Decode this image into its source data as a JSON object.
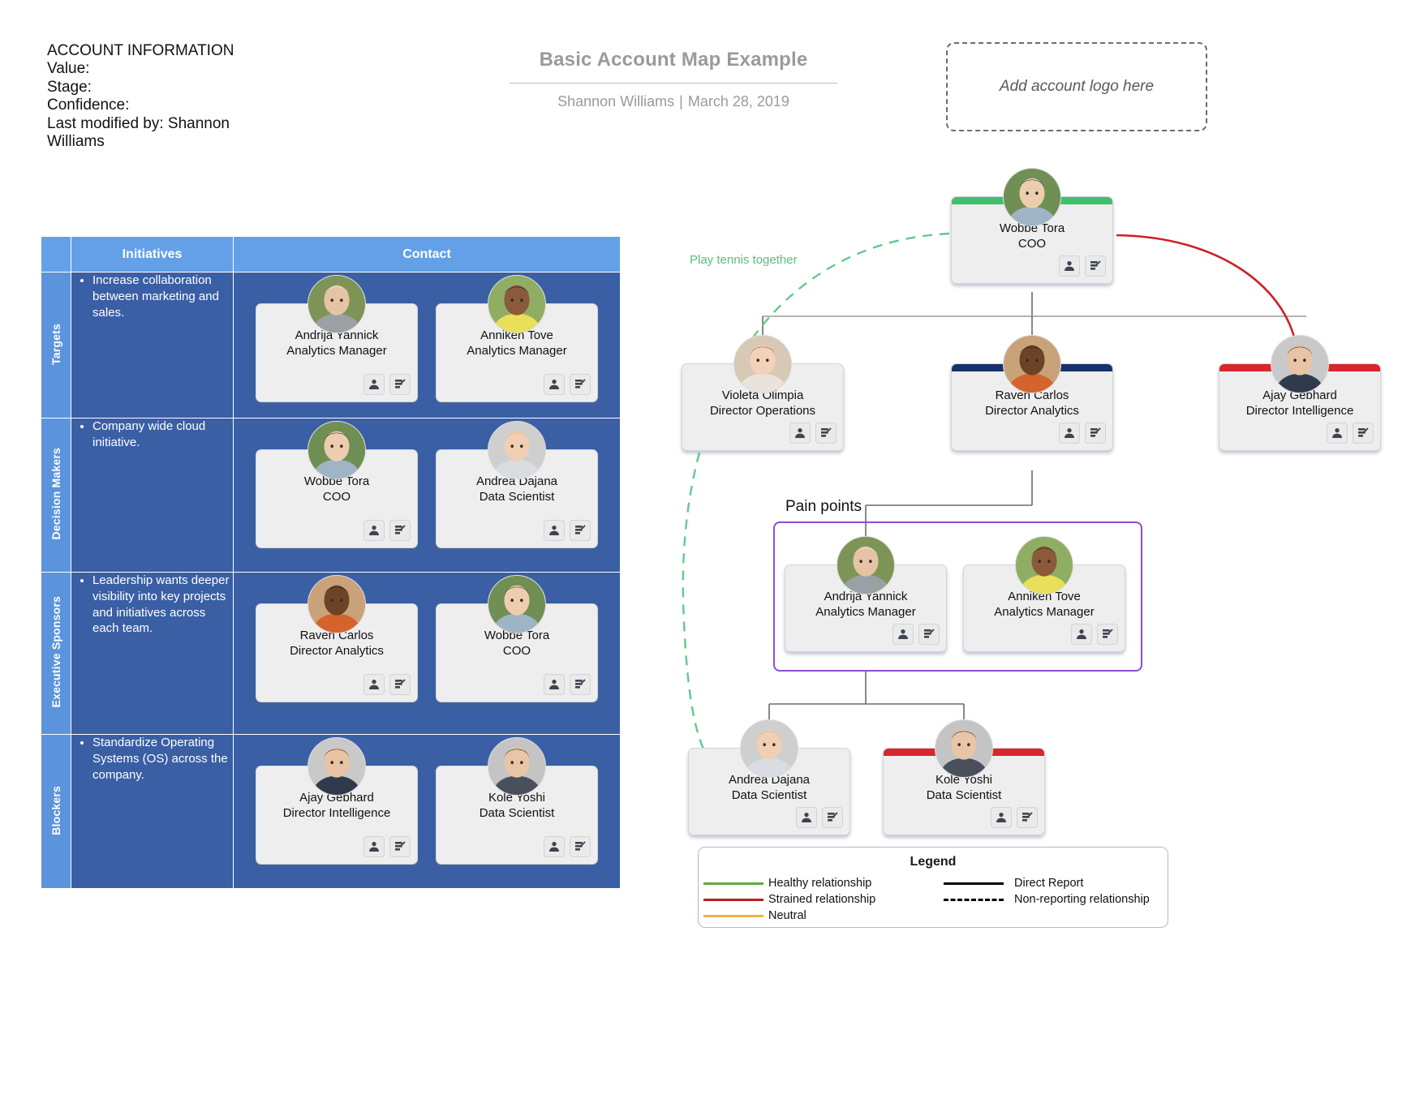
{
  "account_info": {
    "heading": "ACCOUNT INFORMATION",
    "value_label": "Value:",
    "stage_label": "Stage:",
    "confidence_label": "Confidence:",
    "last_modified": "Last modified by: Shannon Williams"
  },
  "title_block": {
    "title": "Basic Account Map Example",
    "author": "Shannon Williams",
    "separator": "|",
    "date": "March 28, 2019"
  },
  "logo_box": {
    "placeholder": "Add account logo here"
  },
  "matrix": {
    "headers": {
      "blank": "",
      "initiatives": "Initiatives",
      "contact": "Contact"
    },
    "rows": [
      {
        "label": "Targets",
        "initiatives": [
          "Increase collaboration between marketing and sales."
        ],
        "contacts": [
          {
            "name": "Andrija Yannick",
            "role": "Analytics Manager",
            "avatar": "older-man-beard"
          },
          {
            "name": "Anniken Tove",
            "role": "Analytics Manager",
            "avatar": "woman-curly-hair"
          }
        ]
      },
      {
        "label": "Decision Makers",
        "initiatives": [
          "Company wide cloud initiative."
        ],
        "contacts": [
          {
            "name": "Wobbe Tora",
            "role": "COO",
            "avatar": "woman-dark-hair"
          },
          {
            "name": "Andrea Dajana",
            "role": "Data Scientist",
            "avatar": "woman-blonde"
          }
        ]
      },
      {
        "label": "Executive Sponsors",
        "initiatives": [
          "Leadership wants deeper visibility into key projects and initiatives across each team."
        ],
        "contacts": [
          {
            "name": "Raven Carlos",
            "role": "Director Analytics",
            "avatar": "man-dark-skin"
          },
          {
            "name": "Wobbe Tora",
            "role": "COO",
            "avatar": "woman-dark-hair"
          }
        ]
      },
      {
        "label": "Blockers",
        "initiatives": [
          "Standardize Operating Systems (OS) across the company."
        ],
        "contacts": [
          {
            "name": "Ajay Gebhard",
            "role": "Director Intelligence",
            "avatar": "man-glasses-beard"
          },
          {
            "name": "Kole Yoshi",
            "role": "Data Scientist",
            "avatar": "man-asian"
          }
        ]
      }
    ]
  },
  "org_chart": {
    "annotations": {
      "tennis": "Play tennis together",
      "pain_points": "Pain points"
    },
    "nodes": [
      {
        "id": "wobbe",
        "name": "Wobbe Tora",
        "role": "COO",
        "avatar": "woman-dark-hair",
        "status": "healthy",
        "top_color": "#3fbf6f"
      },
      {
        "id": "violeta",
        "name": "Violeta Olimpia",
        "role": "Director Operations",
        "avatar": "woman-red-hair",
        "status": "none",
        "top_color": ""
      },
      {
        "id": "raven",
        "name": "Raven Carlos",
        "role": "Director Analytics",
        "avatar": "man-dark-skin",
        "status": "navy",
        "top_color": "#14336b"
      },
      {
        "id": "ajay",
        "name": "Ajay Gebhard",
        "role": "Director Intelligence",
        "avatar": "man-glasses-beard",
        "status": "strained",
        "top_color": "#d8262c"
      },
      {
        "id": "andrija",
        "name": "Andrija Yannick",
        "role": "Analytics Manager",
        "avatar": "older-man-beard",
        "status": "none",
        "top_color": ""
      },
      {
        "id": "anniken",
        "name": "Anniken Tove",
        "role": "Analytics Manager",
        "avatar": "woman-curly-hair",
        "status": "none",
        "top_color": ""
      },
      {
        "id": "andrea",
        "name": "Andrea Dajana",
        "role": "Data Scientist",
        "avatar": "woman-blonde",
        "status": "none",
        "top_color": ""
      },
      {
        "id": "kole",
        "name": "Kole Yoshi",
        "role": "Data Scientist",
        "avatar": "man-asian",
        "status": "strained",
        "top_color": "#d8262c"
      }
    ]
  },
  "legend": {
    "title": "Legend",
    "left_items": [
      {
        "label": "Healthy relationship",
        "color": "#63a83f",
        "style": "solid"
      },
      {
        "label": "Strained relationship",
        "color": "#b7201f",
        "style": "solid"
      },
      {
        "label": "Neutral",
        "color": "#f0b24a",
        "style": "solid"
      }
    ],
    "right_items": [
      {
        "label": "Direct Report",
        "color": "#000000",
        "style": "solid"
      },
      {
        "label": "Non-reporting relationship",
        "color": "#000000",
        "style": "dashed"
      }
    ]
  },
  "icons": {
    "person": "person-icon",
    "note": "note-edit-icon"
  }
}
